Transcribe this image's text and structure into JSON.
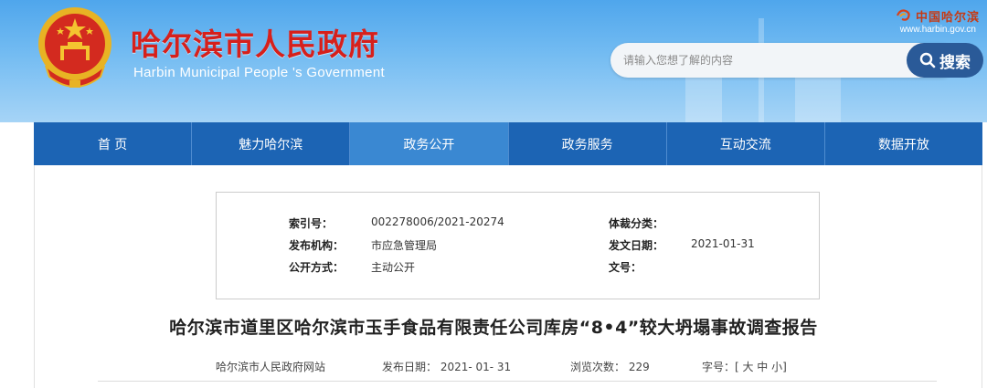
{
  "header": {
    "title_cn": "哈尔滨市人民政府",
    "title_en": "Harbin Municipal People 's Government",
    "brand_text": "中国哈尔滨",
    "brand_url": "www.harbin.gov.cn",
    "search_placeholder": "请输入您想了解的内容",
    "search_button_label": "搜索",
    "colors": {
      "header_top": "#4fa6ec",
      "title_red": "#d6201c",
      "search_button": "#2a5a98"
    }
  },
  "nav": {
    "items": [
      "首 页",
      "魅力哈尔滨",
      "政务公开",
      "政务服务",
      "互动交流",
      "数据开放"
    ],
    "active_index": 2,
    "colors": {
      "bar": "#1c64b4",
      "active": "#3a88d2"
    }
  },
  "info": {
    "index_label": "索引号：",
    "index_value": "002278006/2021-20274",
    "category_label": "体裁分类：",
    "category_value": "",
    "publisher_label": "发布机构：",
    "publisher_value": "市应急管理局",
    "date_label": "发文日期：",
    "date_value": "2021-01-31",
    "publicity_label": "公开方式：",
    "publicity_value": "主动公开",
    "doc_no_label": "文号："
  },
  "article": {
    "title": "哈尔滨市道里区哈尔滨市玉手食品有限责任公司库房“8•4”较大坍塌事故调查报告",
    "source": "哈尔滨市人民政府网站",
    "publish_date": "发布日期： 2021- 01- 31",
    "views": "浏览次数： 229",
    "font_size": "字号：[ 大 中 小]"
  }
}
